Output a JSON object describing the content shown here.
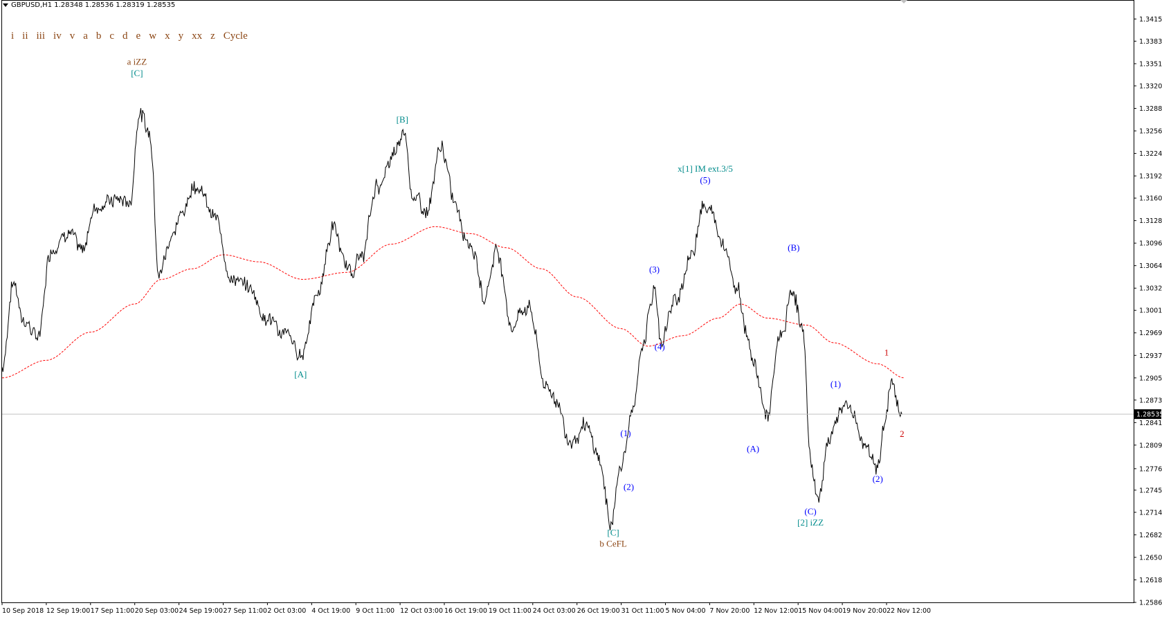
{
  "header": {
    "symbol_line": "GBPUSD,H1  1.28348 1.28536 1.28319 1.28535"
  },
  "menu": [
    "i",
    "ii",
    "iii",
    "iv",
    "v",
    "a",
    "b",
    "c",
    "d",
    "e",
    "w",
    "x",
    "y",
    "xx",
    "z",
    "Cycle"
  ],
  "colors": {
    "price": "#000000",
    "ma": "#ff0000",
    "teal": "#008b8b",
    "blue": "#0000ff",
    "brown": "#8b4513",
    "red": "#cc0000"
  },
  "chart_data": {
    "type": "line",
    "title": "GBPUSD,H1",
    "ylim": [
      1.2586,
      1.3442
    ],
    "current_price": "1.28535",
    "y_ticks": [
      "1.34150",
      "1.33835",
      "1.33515",
      "1.33200",
      "1.32880",
      "1.32560",
      "1.32240",
      "1.31920",
      "1.31605",
      "1.31285",
      "1.30965",
      "1.30645",
      "1.30325",
      "1.30010",
      "1.29690",
      "1.29370",
      "1.29050",
      "1.28735",
      "1.28415",
      "1.28095",
      "1.27760",
      "1.27455",
      "1.27140",
      "1.26820",
      "1.26500",
      "1.26180",
      "1.25860"
    ],
    "x_ticks": [
      "10 Sep 2018",
      "12 Sep 19:00",
      "17 Sep 11:00",
      "20 Sep 03:00",
      "24 Sep 19:00",
      "27 Sep 11:00",
      "2 Oct 03:00",
      "4 Oct 19:00",
      "9 Oct 11:00",
      "12 Oct 03:00",
      "16 Oct 19:00",
      "19 Oct 11:00",
      "24 Oct 03:00",
      "26 Oct 19:00",
      "31 Oct 11:00",
      "5 Nov 04:00",
      "7 Nov 20:00",
      "12 Nov 12:00",
      "15 Nov 04:00",
      "19 Nov 20:00",
      "22 Nov 12:00"
    ],
    "price_anchors": [
      {
        "x": 0,
        "y": 1.292
      },
      {
        "x": 0.25,
        "y": 1.304
      },
      {
        "x": 0.5,
        "y": 1.299
      },
      {
        "x": 0.8,
        "y": 1.296
      },
      {
        "x": 1.1,
        "y": 1.309
      },
      {
        "x": 1.5,
        "y": 1.312
      },
      {
        "x": 1.8,
        "y": 1.308
      },
      {
        "x": 2.1,
        "y": 1.315
      },
      {
        "x": 2.6,
        "y": 1.316
      },
      {
        "x": 2.9,
        "y": 1.3155
      },
      {
        "x": 3.1,
        "y": 1.3285
      },
      {
        "x": 3.35,
        "y": 1.325
      },
      {
        "x": 3.55,
        "y": 1.306
      },
      {
        "x": 3.9,
        "y": 1.312
      },
      {
        "x": 4.4,
        "y": 1.3185
      },
      {
        "x": 4.8,
        "y": 1.313
      },
      {
        "x": 5.2,
        "y": 1.305
      },
      {
        "x": 5.6,
        "y": 1.303
      },
      {
        "x": 6.0,
        "y": 1.299
      },
      {
        "x": 6.35,
        "y": 1.297
      },
      {
        "x": 6.75,
        "y": 1.2935
      },
      {
        "x": 7.1,
        "y": 1.302
      },
      {
        "x": 7.5,
        "y": 1.312
      },
      {
        "x": 7.8,
        "y": 1.306
      },
      {
        "x": 8.1,
        "y": 1.307
      },
      {
        "x": 8.5,
        "y": 1.318
      },
      {
        "x": 8.9,
        "y": 1.322
      },
      {
        "x": 9.1,
        "y": 1.3255
      },
      {
        "x": 9.3,
        "y": 1.316
      },
      {
        "x": 9.6,
        "y": 1.314
      },
      {
        "x": 9.95,
        "y": 1.323
      },
      {
        "x": 10.2,
        "y": 1.316
      },
      {
        "x": 10.6,
        "y": 1.31
      },
      {
        "x": 10.9,
        "y": 1.302
      },
      {
        "x": 11.2,
        "y": 1.309
      },
      {
        "x": 11.5,
        "y": 1.298
      },
      {
        "x": 11.9,
        "y": 1.301
      },
      {
        "x": 12.3,
        "y": 1.289
      },
      {
        "x": 12.6,
        "y": 1.287
      },
      {
        "x": 12.8,
        "y": 1.2815
      },
      {
        "x": 13.2,
        "y": 1.283
      },
      {
        "x": 13.5,
        "y": 1.279
      },
      {
        "x": 13.75,
        "y": 1.27
      },
      {
        "x": 14.0,
        "y": 1.278
      },
      {
        "x": 14.25,
        "y": 1.285
      },
      {
        "x": 14.5,
        "y": 1.296
      },
      {
        "x": 14.75,
        "y": 1.303
      },
      {
        "x": 14.9,
        "y": 1.296
      },
      {
        "x": 15.2,
        "y": 1.301
      },
      {
        "x": 15.6,
        "y": 1.308
      },
      {
        "x": 15.85,
        "y": 1.316
      },
      {
        "x": 16.0,
        "y": 1.314
      },
      {
        "x": 16.3,
        "y": 1.3105
      },
      {
        "x": 16.6,
        "y": 1.304
      },
      {
        "x": 16.85,
        "y": 1.297
      },
      {
        "x": 17.0,
        "y": 1.292
      },
      {
        "x": 17.3,
        "y": 1.285
      },
      {
        "x": 17.6,
        "y": 1.296
      },
      {
        "x": 17.9,
        "y": 1.303
      },
      {
        "x": 18.1,
        "y": 1.297
      },
      {
        "x": 18.3,
        "y": 1.278
      },
      {
        "x": 18.45,
        "y": 1.273
      },
      {
        "x": 18.7,
        "y": 1.282
      },
      {
        "x": 18.95,
        "y": 1.286
      },
      {
        "x": 19.2,
        "y": 1.286
      },
      {
        "x": 19.5,
        "y": 1.281
      },
      {
        "x": 19.8,
        "y": 1.2785
      },
      {
        "x": 19.95,
        "y": 1.283
      },
      {
        "x": 20.1,
        "y": 1.2895
      },
      {
        "x": 20.25,
        "y": 1.2875
      },
      {
        "x": 20.35,
        "y": 1.2853
      }
    ],
    "ma_anchors": [
      {
        "x": 0,
        "y": 1.2905
      },
      {
        "x": 1,
        "y": 1.293
      },
      {
        "x": 2,
        "y": 1.297
      },
      {
        "x": 3,
        "y": 1.301
      },
      {
        "x": 3.6,
        "y": 1.3045
      },
      {
        "x": 4.3,
        "y": 1.306
      },
      {
        "x": 5,
        "y": 1.308
      },
      {
        "x": 5.8,
        "y": 1.307
      },
      {
        "x": 6.8,
        "y": 1.3045
      },
      {
        "x": 7.8,
        "y": 1.3055
      },
      {
        "x": 8.8,
        "y": 1.3095
      },
      {
        "x": 9.8,
        "y": 1.312
      },
      {
        "x": 10.6,
        "y": 1.311
      },
      {
        "x": 11.4,
        "y": 1.309
      },
      {
        "x": 12.2,
        "y": 1.306
      },
      {
        "x": 13.0,
        "y": 1.302
      },
      {
        "x": 14.0,
        "y": 1.2975
      },
      {
        "x": 14.6,
        "y": 1.295
      },
      {
        "x": 15.4,
        "y": 1.2965
      },
      {
        "x": 16.2,
        "y": 1.299
      },
      {
        "x": 16.7,
        "y": 1.301
      },
      {
        "x": 17.3,
        "y": 1.299
      },
      {
        "x": 18.2,
        "y": 1.298
      },
      {
        "x": 18.8,
        "y": 1.2955
      },
      {
        "x": 19.8,
        "y": 1.2925
      },
      {
        "x": 20.4,
        "y": 1.2905
      }
    ],
    "annotations": [
      {
        "text": "a iZZ",
        "x": 3.05,
        "y": 1.335,
        "color": "brown"
      },
      {
        "text": "[C]",
        "x": 3.05,
        "y": 1.3334,
        "color": "teal"
      },
      {
        "text": "[A]",
        "x": 6.75,
        "y": 1.2906,
        "color": "teal"
      },
      {
        "text": "[B]",
        "x": 9.05,
        "y": 1.3268,
        "color": "teal"
      },
      {
        "text": "x[1] IM ext.3/5",
        "x": 15.9,
        "y": 1.3198,
        "color": "teal"
      },
      {
        "text": "(5)",
        "x": 15.9,
        "y": 1.3182,
        "color": "blue"
      },
      {
        "text": "(3)",
        "x": 14.75,
        "y": 1.3055,
        "color": "blue"
      },
      {
        "text": "(4)",
        "x": 14.87,
        "y": 1.2945,
        "color": "blue"
      },
      {
        "text": "(1)",
        "x": 14.1,
        "y": 1.2822,
        "color": "blue"
      },
      {
        "text": "(2)",
        "x": 14.17,
        "y": 1.2746,
        "color": "blue"
      },
      {
        "text": "[C]",
        "x": 13.82,
        "y": 1.2681,
        "color": "teal"
      },
      {
        "text": "b CeFL",
        "x": 13.82,
        "y": 1.2665,
        "color": "brown"
      },
      {
        "text": "(A)",
        "x": 16.98,
        "y": 1.28,
        "color": "blue"
      },
      {
        "text": "(B)",
        "x": 17.9,
        "y": 1.3086,
        "color": "blue"
      },
      {
        "text": "(C)",
        "x": 18.28,
        "y": 1.2711,
        "color": "blue"
      },
      {
        "text": "[2] iZZ",
        "x": 18.28,
        "y": 1.2695,
        "color": "teal"
      },
      {
        "text": "(1)",
        "x": 18.85,
        "y": 1.2892,
        "color": "blue"
      },
      {
        "text": "(2)",
        "x": 19.8,
        "y": 1.2757,
        "color": "blue"
      },
      {
        "text": "1",
        "x": 20.0,
        "y": 1.2937,
        "color": "red"
      },
      {
        "text": "2",
        "x": 20.35,
        "y": 1.2821,
        "color": "red"
      }
    ]
  }
}
